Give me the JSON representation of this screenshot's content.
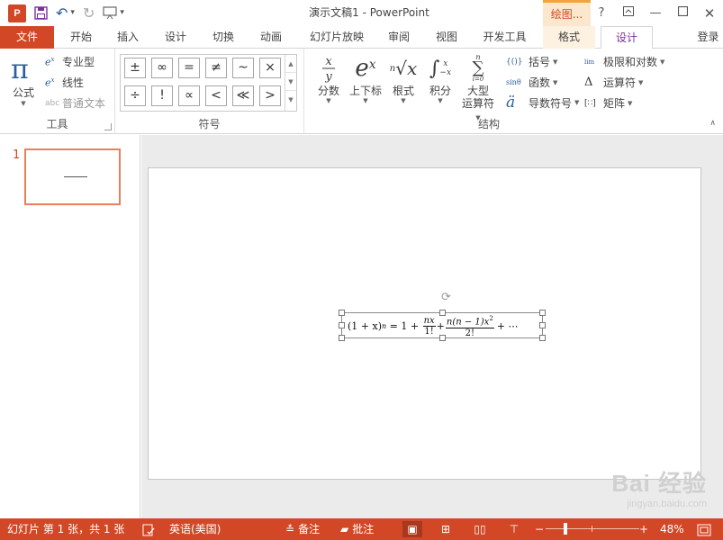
{
  "titlebar": {
    "app_logo_text": "P",
    "qat": {
      "save_icon": "save-icon",
      "undo_icon": "undo-icon",
      "redo_icon": "redo-icon",
      "start_icon": "present-from-start-icon"
    },
    "title": "演示文稿1 - PowerPoint",
    "contextual_tab": "绘图...",
    "window_controls": {
      "help": "?",
      "ribbon_display": "ribbon-display-icon",
      "minimize": "minimize-icon",
      "restore": "restore-icon",
      "close": "close-icon"
    }
  },
  "tabs": {
    "file": "文件",
    "home": "开始",
    "insert": "插入",
    "design": "设计",
    "transitions": "切换",
    "animations": "动画",
    "slideshow": "幻灯片放映",
    "review": "审阅",
    "view": "视图",
    "developer": "开发工具",
    "format": "格式",
    "eq_design": "设计",
    "signin": "登录"
  },
  "ribbon": {
    "tools": {
      "label": "工具",
      "equation_glyph": "π",
      "equation": "公式",
      "professional": "专业型",
      "linear": "线性",
      "normal_text": "普通文本",
      "normal_text_icon": "abc"
    },
    "symbols": {
      "label": "符号",
      "items": [
        "±",
        "∞",
        "=",
        "≠",
        "~",
        "×",
        "÷",
        "!",
        "∝",
        "<",
        "≪",
        ">"
      ]
    },
    "structures": {
      "label": "结构",
      "fraction": "分数",
      "script": "上下标",
      "radical": "根式",
      "integral": "积分",
      "large_operator_line1": "大型",
      "large_operator_line2": "运算符",
      "bracket": "括号",
      "function": "函数",
      "accent": "导数符号",
      "limit_log": "极限和对数",
      "operator": "运算符",
      "matrix": "矩阵",
      "bracket_icon_text": "{()}",
      "function_icon_text": "sinθ",
      "accent_icon_text": "ä",
      "limit_icon_text": "lim",
      "operator_icon_text": "Δ",
      "matrix_icon_text": "[∷]"
    }
  },
  "thumbnails": [
    {
      "number": "1"
    }
  ],
  "equation": {
    "lhs": "(1 + x)",
    "lhs_exp": "n",
    "eq": " = 1 + ",
    "f1_num": "nx",
    "f1_den": "1!",
    "plus": "+",
    "f2_num": "n(n − 1)x",
    "f2_num_exp": "2",
    "f2_den": "2!",
    "tail": "+ ⋯"
  },
  "watermark": {
    "main": "Bai 经验",
    "sub": "jingyan.baidu.com"
  },
  "statusbar": {
    "slide_info": "幻灯片 第 1 张，共 1 张",
    "language": "英语(美国)",
    "notes": "备注",
    "comments": "批注",
    "zoom_minus": "−",
    "zoom_plus": "+",
    "zoom_value": "48%",
    "zoom_level_percent": 48
  },
  "colors": {
    "accent": "#d24726",
    "context_tab": "#f3a33a",
    "eq_design_tab_text": "#7b2fa0"
  }
}
